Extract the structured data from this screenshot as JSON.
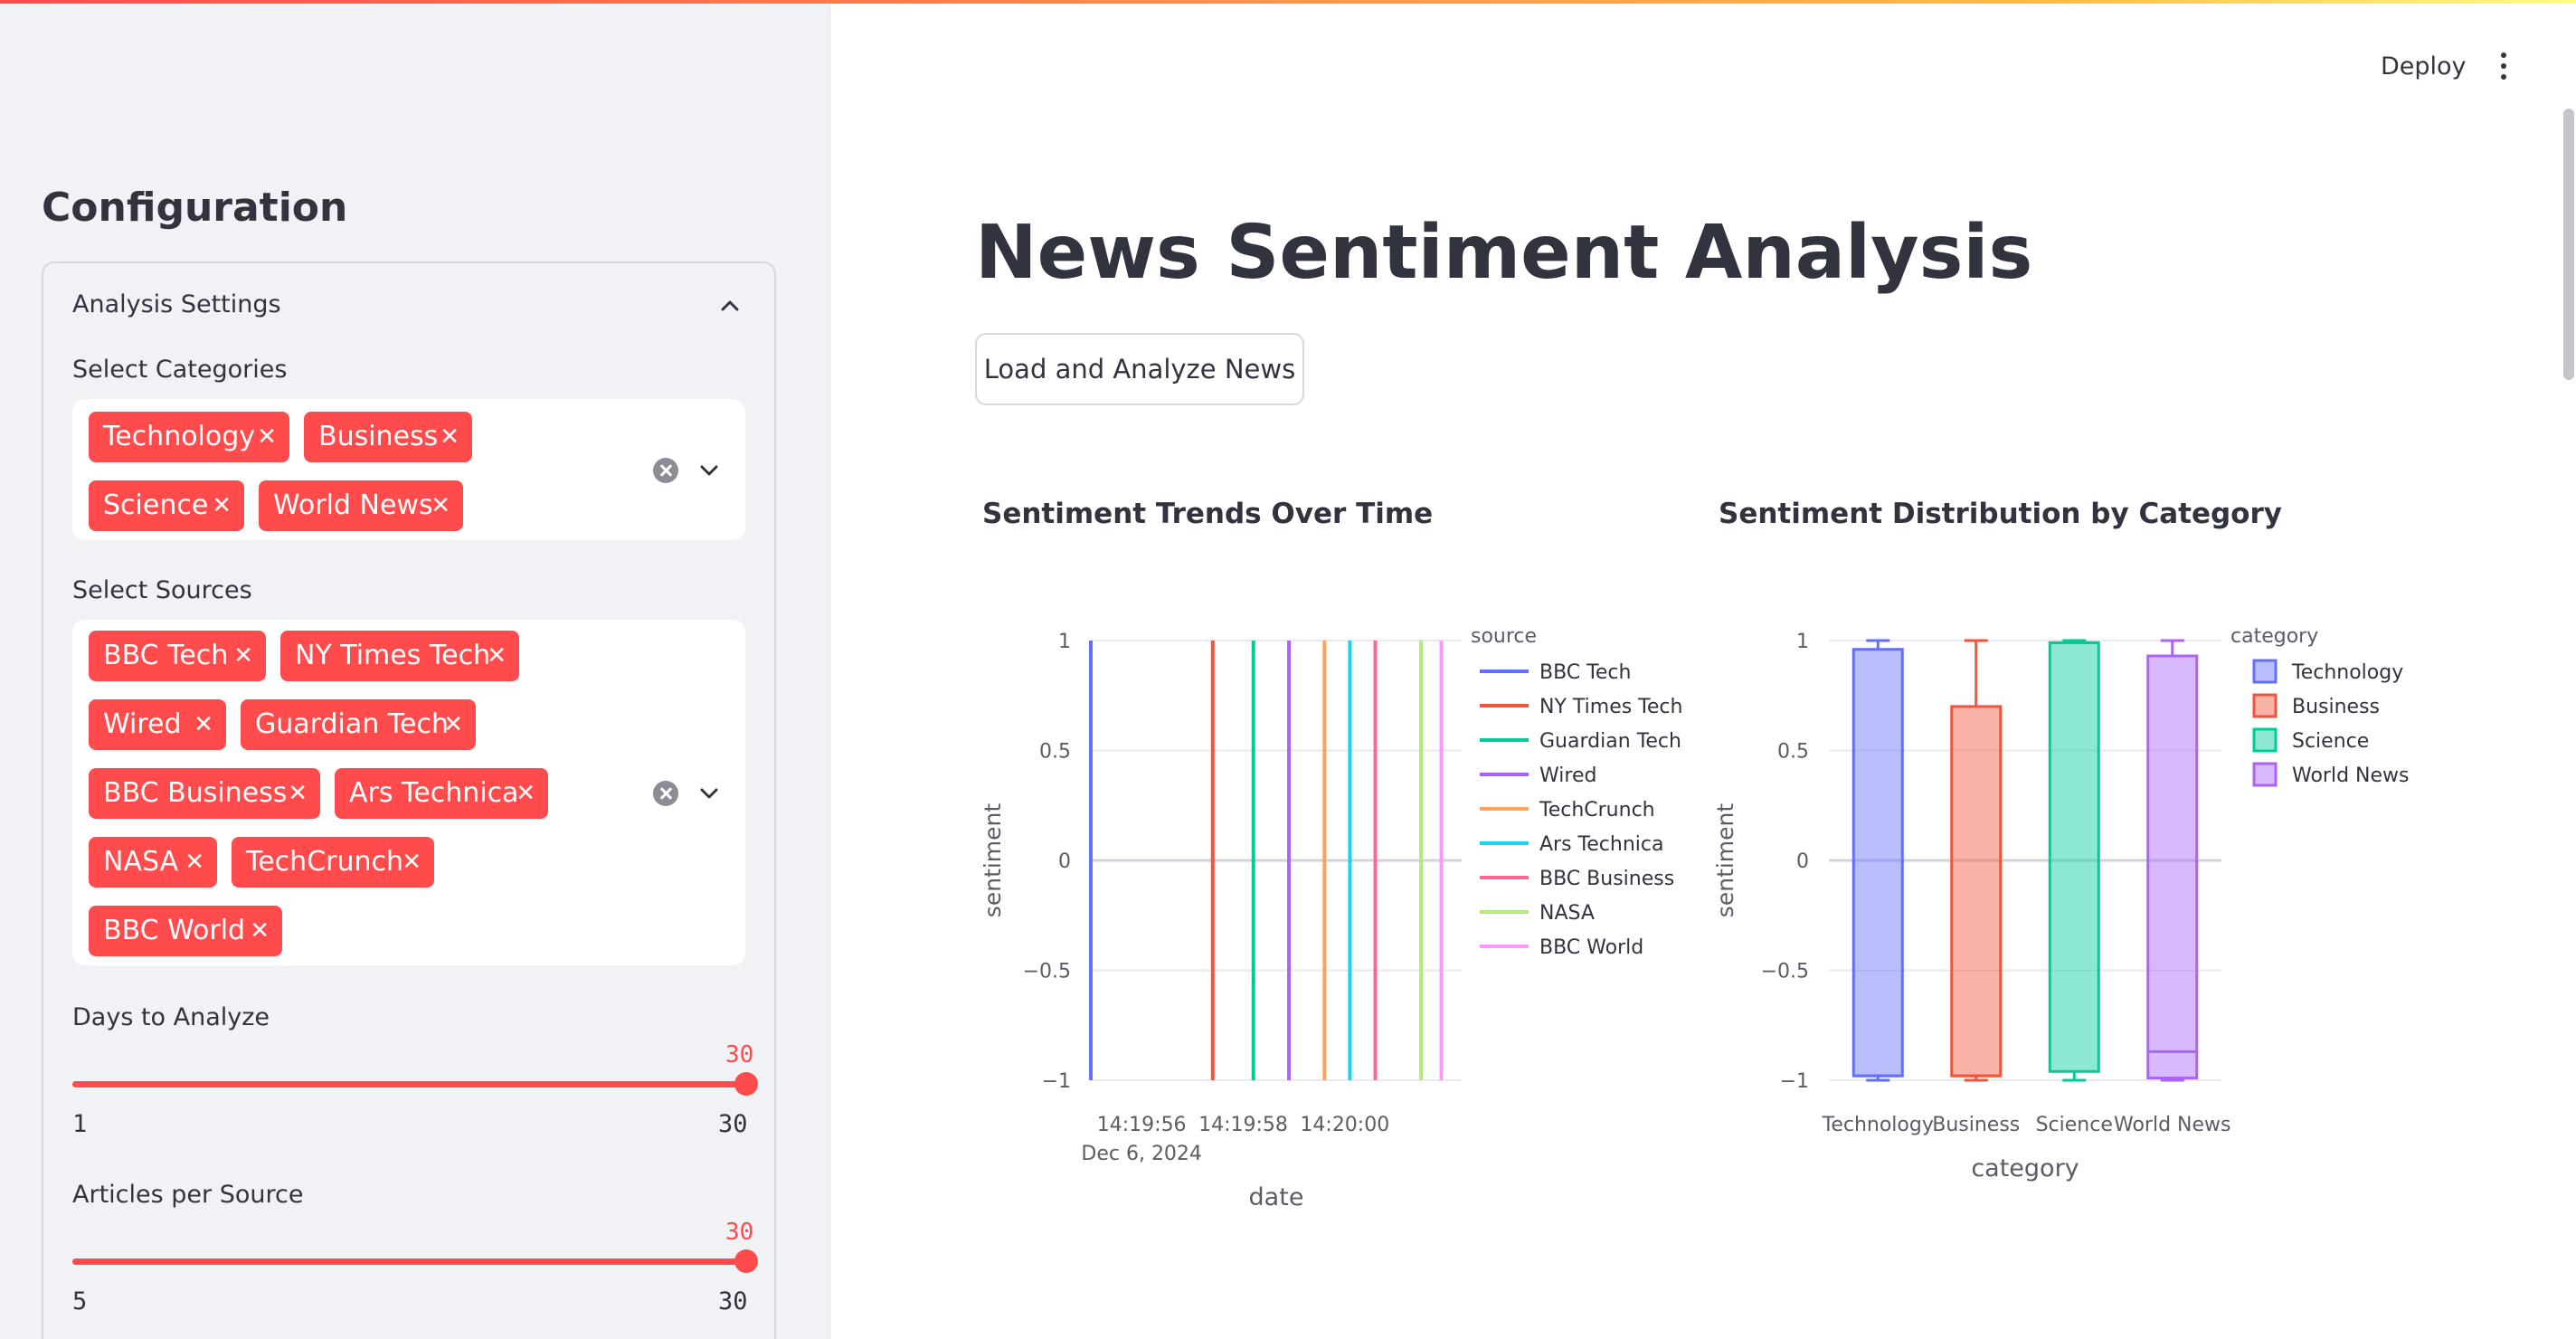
{
  "sidebar": {
    "title": "Configuration",
    "expander": {
      "label": "Analysis Settings"
    },
    "categories": {
      "label": "Select Categories",
      "selected": [
        "Technology",
        "Business",
        "Science",
        "World News"
      ]
    },
    "sources": {
      "label": "Select Sources",
      "selected": [
        "BBC Tech",
        "NY Times Tech",
        "Wired",
        "Guardian Tech",
        "BBC Business",
        "Ars Technica",
        "NASA",
        "TechCrunch",
        "BBC World"
      ]
    },
    "days": {
      "label": "Days to Analyze",
      "value": "30",
      "min": "1",
      "max": "30"
    },
    "articles": {
      "label": "Articles per Source",
      "value": "30",
      "min": "5",
      "max": "30"
    }
  },
  "header": {
    "deploy_label": "Deploy"
  },
  "main": {
    "title": "News Sentiment Analysis",
    "load_button": "Load and Analyze News"
  },
  "colors": {
    "accent": "#ff4b4b"
  },
  "chart_data": [
    {
      "type": "line",
      "title": "Sentiment Trends Over Time",
      "xlabel": "date",
      "ylabel": "sentiment",
      "ylim": [
        -1,
        1
      ],
      "yticks": [
        "1",
        "0.5",
        "0",
        "−0.5",
        "−1"
      ],
      "xticks": [
        "14:19:56",
        "14:19:58",
        "14:20:00"
      ],
      "xtick_sub": "Dec 6, 2024",
      "grid": true,
      "legend": {
        "title": "source",
        "placement": "right"
      },
      "series": [
        {
          "name": "BBC Tech",
          "color": "#636efa",
          "x": "14:19:55",
          "y": [
            -1,
            1
          ]
        },
        {
          "name": "NY Times Tech",
          "color": "#ef553b",
          "x": "14:19:57.4",
          "y": [
            -1,
            1
          ]
        },
        {
          "name": "Guardian Tech",
          "color": "#00cc96",
          "x": "14:19:58.2",
          "y": [
            -1,
            1
          ]
        },
        {
          "name": "Wired",
          "color": "#ab63fa",
          "x": "14:19:58.9",
          "y": [
            -1,
            1
          ]
        },
        {
          "name": "TechCrunch",
          "color": "#ffa15a",
          "x": "14:19:59.6",
          "y": [
            -1,
            1
          ]
        },
        {
          "name": "Ars Technica",
          "color": "#19d3f3",
          "x": "14:20:00.1",
          "y": [
            -1,
            1
          ]
        },
        {
          "name": "BBC Business",
          "color": "#ff6692",
          "x": "14:20:00.6",
          "y": [
            -1,
            1
          ]
        },
        {
          "name": "NASA",
          "color": "#b6e880",
          "x": "14:20:01.5",
          "y": [
            -1,
            1
          ]
        },
        {
          "name": "BBC World",
          "color": "#ff97ff",
          "x": "14:20:01.9",
          "y": [
            -1,
            1
          ]
        }
      ]
    },
    {
      "type": "box",
      "title": "Sentiment Distribution by Category",
      "xlabel": "category",
      "ylabel": "sentiment",
      "ylim": [
        -1,
        1
      ],
      "yticks": [
        "1",
        "0.5",
        "0",
        "−0.5",
        "−1"
      ],
      "categories": [
        "Technology",
        "Business",
        "Science",
        "World News"
      ],
      "grid": true,
      "legend": {
        "title": "category",
        "placement": "right"
      },
      "series": [
        {
          "name": "Technology",
          "color": "#636efa",
          "min": -1,
          "q1": -0.98,
          "median": -0.98,
          "q3": 0.96,
          "max": 1
        },
        {
          "name": "Business",
          "color": "#ef553b",
          "min": -1,
          "q1": -0.98,
          "median": -0.98,
          "q3": 0.7,
          "max": 1
        },
        {
          "name": "Science",
          "color": "#00cc96",
          "min": -1,
          "q1": -0.96,
          "median": 0.99,
          "q3": 0.99,
          "max": 1
        },
        {
          "name": "World News",
          "color": "#ab63fa",
          "min": -1,
          "q1": -0.99,
          "median": -0.87,
          "q3": 0.93,
          "max": 1
        }
      ]
    }
  ]
}
